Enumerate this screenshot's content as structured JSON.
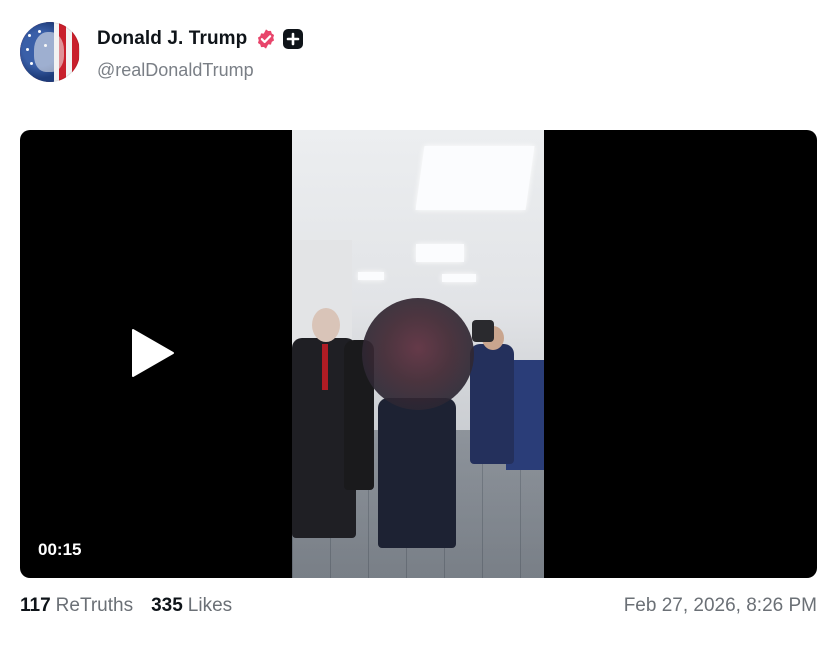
{
  "author": {
    "display_name": "Donald J. Trump",
    "handle": "@realDonaldTrump",
    "avatar_icon": "profile-avatar",
    "verified_icon": "verified-badge-icon",
    "verified_color": "#e8456b",
    "plus_icon": "plus-badge-icon"
  },
  "video": {
    "duration": "00:15",
    "play_icon": "play-icon"
  },
  "stats": {
    "retruths_count": "117",
    "retruths_label": "ReTruths",
    "likes_count": "335",
    "likes_label": "Likes"
  },
  "timestamp": "Feb 27, 2026, 8:26 PM"
}
